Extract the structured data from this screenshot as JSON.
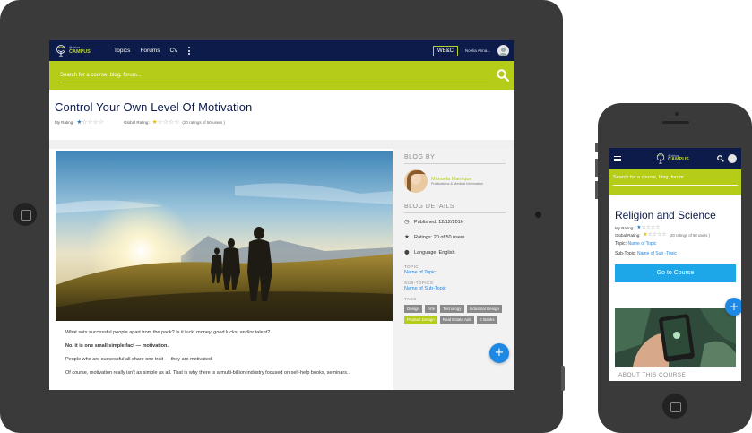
{
  "tablet": {
    "nav": {
      "logo_line1": "@drive",
      "logo_line2": "CAMPUS",
      "menu": [
        "Topics",
        "Forums",
        "CV"
      ],
      "brand_badge": "WE&C",
      "user_name": "Noelia Anna..."
    },
    "search": {
      "placeholder": "Search for a course, blog, forum..."
    },
    "header": {
      "title": "Control Your Own Level Of Motivation",
      "my_rating_label": "My Rating:",
      "my_rating_stars": 1,
      "global_rating_label": "Global Rating:",
      "global_rating_stars": 1,
      "rating_count": "(20 ratings of 50 users )"
    },
    "article": {
      "paragraphs": [
        "What sets successful people apart from the pack? Is it luck, money, good lucks, and/or talent?",
        "No, it is one small simple fact — motivation.",
        "People who are successful all share one trait — they are motivated.",
        "Of course, motivation really isn't as simple as all. That is why there is a multi-billion industry focused on self-help books, seminars..."
      ]
    },
    "sidebar": {
      "blog_by_heading": "BLOG BY",
      "author_name": "Manuela Manrique",
      "author_role": "Publications & Medical Information",
      "details_heading": "BLOG DETAILS",
      "published": "Published: 12/12/2016",
      "ratings": "Ratings: 20 of 50 users",
      "language": "Language: English",
      "topic_heading": "TOPIC",
      "topic_value": "Name of Topic",
      "subtopics_heading": "SUB-TOPICS",
      "subtopics_value": "Name of  Sub-Topic",
      "tags_heading": "TAGS",
      "tags": [
        {
          "label": "Design",
          "highlight": false
        },
        {
          "label": "Arte",
          "highlight": false
        },
        {
          "label": "Tecnology",
          "highlight": false
        },
        {
          "label": "Industrial Design",
          "highlight": false
        },
        {
          "label": "Product Design",
          "highlight": true
        },
        {
          "label": "Real Estate Ads",
          "highlight": false
        },
        {
          "label": "E Banks",
          "highlight": false
        }
      ]
    },
    "fab_label": "+"
  },
  "phone": {
    "nav": {
      "logo_line1": "@drive",
      "logo_line2": "CAMPUS"
    },
    "search": {
      "placeholder": "Search for a course, blog, forum..."
    },
    "title": "Religion and Science",
    "my_rating_label": "My Rating:",
    "global_rating_label": "Global Rating:",
    "rating_count": "(20 ratings of 50 users )",
    "topic_label": "Topic:",
    "topic_value": "Name of Topic",
    "subtopic_label": "Sub-Topic:",
    "subtopic_value": "Name of Sub -Topic",
    "cta": "Go to Course",
    "about_heading": "ABOUT THIS COURSE",
    "fab_label": "+"
  },
  "colors": {
    "navy": "#0d1b4b",
    "lime": "#b5cc18",
    "blue": "#1e88e5",
    "star_blue": "#1e73be",
    "star_yellow": "#e6b800"
  }
}
